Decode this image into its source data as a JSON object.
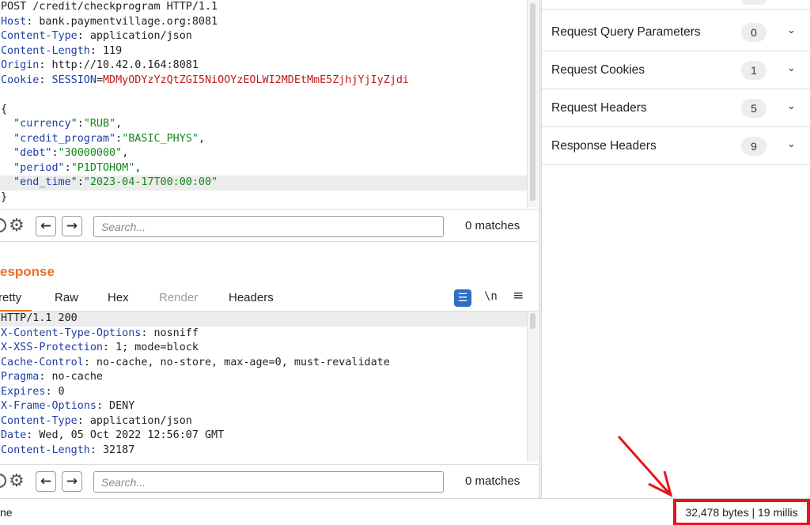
{
  "request": {
    "lines": [
      [
        {
          "t": "POST /credit/checkprogram HTTP/1.1",
          "c": "v"
        }
      ],
      [
        {
          "t": "Host",
          "c": "k"
        },
        {
          "t": ": bank.paymentvillage.org:8081",
          "c": "v"
        }
      ],
      [
        {
          "t": "Content-Type",
          "c": "k"
        },
        {
          "t": ": application/json",
          "c": "v"
        }
      ],
      [
        {
          "t": "Content-Length",
          "c": "k"
        },
        {
          "t": ": 119",
          "c": "v"
        }
      ],
      [
        {
          "t": "Origin",
          "c": "k"
        },
        {
          "t": ": http://10.42.0.164:8081",
          "c": "v"
        }
      ],
      [
        {
          "t": "Cookie",
          "c": "k"
        },
        {
          "t": ": ",
          "c": "v"
        },
        {
          "t": "SESSION",
          "c": "k"
        },
        {
          "t": "=",
          "c": "eq"
        },
        {
          "t": "MDMyODYzYzQtZGI5NiOOYzEOLWI2MDEtMmE5ZjhjYjIyZjdi",
          "c": "ck"
        }
      ],
      [],
      [
        {
          "t": "{",
          "c": "p"
        }
      ],
      [
        {
          "t": "  ",
          "c": "p"
        },
        {
          "t": "\"currency\"",
          "c": "k"
        },
        {
          "t": ":",
          "c": "p"
        },
        {
          "t": "\"RUB\"",
          "c": "s"
        },
        {
          "t": ",",
          "c": "p"
        }
      ],
      [
        {
          "t": "  ",
          "c": "p"
        },
        {
          "t": "\"credit_program\"",
          "c": "k"
        },
        {
          "t": ":",
          "c": "p"
        },
        {
          "t": "\"BASIC_PHYS\"",
          "c": "s"
        },
        {
          "t": ",",
          "c": "p"
        }
      ],
      [
        {
          "t": "  ",
          "c": "p"
        },
        {
          "t": "\"debt\"",
          "c": "k"
        },
        {
          "t": ":",
          "c": "p"
        },
        {
          "t": "\"30000000\"",
          "c": "s"
        },
        {
          "t": ",",
          "c": "p"
        }
      ],
      [
        {
          "t": "  ",
          "c": "p"
        },
        {
          "t": "\"period\"",
          "c": "k"
        },
        {
          "t": ":",
          "c": "p"
        },
        {
          "t": "\"P1DTOHOM\"",
          "c": "s"
        },
        {
          "t": ",",
          "c": "p"
        }
      ],
      [
        {
          "t": "  ",
          "c": "p"
        },
        {
          "t": "\"end_time\"",
          "c": "k"
        },
        {
          "t": ":",
          "c": "p"
        },
        {
          "t": "\"2023-04-17T00:00:00\"",
          "c": "s"
        }
      ],
      [
        {
          "t": "}",
          "c": "p"
        }
      ]
    ],
    "highlight_line": 12,
    "search": {
      "placeholder": "Search...",
      "matches": "0 matches"
    }
  },
  "response": {
    "title": "esponse",
    "tabs": [
      {
        "label": "retty",
        "active": true,
        "disabled": false
      },
      {
        "label": "Raw",
        "active": false,
        "disabled": false
      },
      {
        "label": "Hex",
        "active": false,
        "disabled": false
      },
      {
        "label": "Render",
        "active": false,
        "disabled": true
      },
      {
        "label": "Headers",
        "active": false,
        "disabled": false
      }
    ],
    "newline_label": "\\n",
    "lines": [
      [
        {
          "t": "HTTP/1.1 200",
          "c": "v"
        }
      ],
      [
        {
          "t": "X-Content-Type-Options",
          "c": "k"
        },
        {
          "t": ": nosniff",
          "c": "v"
        }
      ],
      [
        {
          "t": "X-XSS-Protection",
          "c": "k"
        },
        {
          "t": ": 1; mode=block",
          "c": "v"
        }
      ],
      [
        {
          "t": "Cache-Control",
          "c": "k"
        },
        {
          "t": ": no-cache, no-store, max-age=0, must-revalidate",
          "c": "v"
        }
      ],
      [
        {
          "t": "Pragma",
          "c": "k"
        },
        {
          "t": ": no-cache",
          "c": "v"
        }
      ],
      [
        {
          "t": "Expires",
          "c": "k"
        },
        {
          "t": ": 0",
          "c": "v"
        }
      ],
      [
        {
          "t": "X-Frame-Options",
          "c": "k"
        },
        {
          "t": ": DENY",
          "c": "v"
        }
      ],
      [
        {
          "t": "Content-Type",
          "c": "k"
        },
        {
          "t": ": application/json",
          "c": "v"
        }
      ],
      [
        {
          "t": "Date",
          "c": "k"
        },
        {
          "t": ": Wed, 05 Oct 2022 12:56:07 GMT",
          "c": "v"
        }
      ],
      [
        {
          "t": "Content-Length",
          "c": "k"
        },
        {
          "t": ": 32187",
          "c": "v"
        }
      ]
    ],
    "highlight_line": 0,
    "search": {
      "placeholder": "Search...",
      "matches": "0 matches"
    }
  },
  "inspector": {
    "sections": [
      {
        "label": "Request Query Parameters",
        "count": "0"
      },
      {
        "label": "Request Cookies",
        "count": "1"
      },
      {
        "label": "Request Headers",
        "count": "5"
      },
      {
        "label": "Response Headers",
        "count": "9"
      }
    ]
  },
  "status": {
    "left": "ne",
    "right": "32,478 bytes | 19 millis"
  },
  "colors": {
    "accent": "#ee6e2a",
    "key": "#1d3ea8",
    "string": "#13881c",
    "cookie": "#c21a1a",
    "annotation": "#e8141b"
  }
}
